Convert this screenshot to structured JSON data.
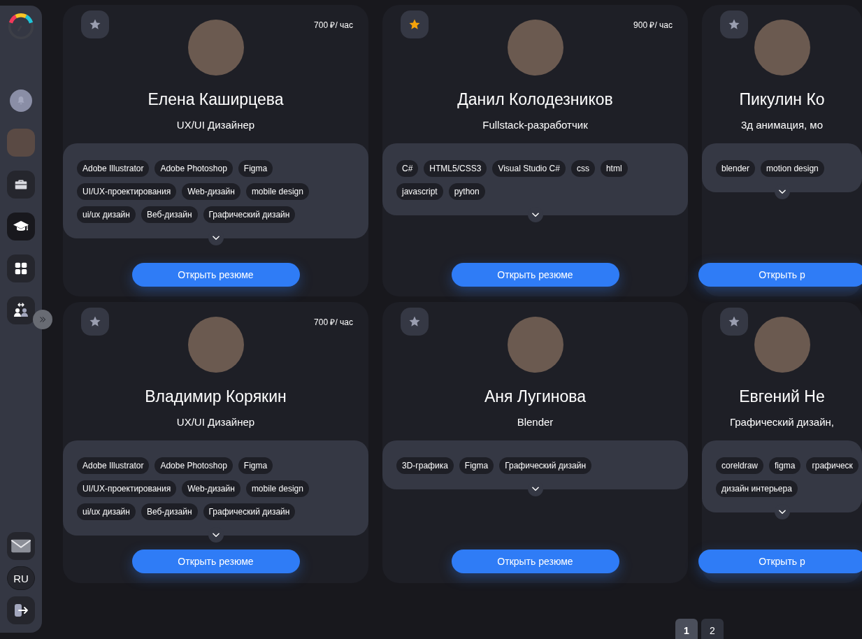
{
  "sidebar": {
    "nav": [
      {
        "kind": "bell",
        "selected": false
      },
      {
        "kind": "avatar",
        "selected": false
      },
      {
        "kind": "briefcase",
        "selected": false
      },
      {
        "kind": "cap",
        "selected": true
      },
      {
        "kind": "grid",
        "selected": false
      },
      {
        "kind": "people",
        "selected": false
      }
    ],
    "language": "RU"
  },
  "cards": [
    {
      "favorite": false,
      "price": "700 ₽/ час",
      "name": "Елена Каширцева",
      "role": "UX/UI Дизайнер",
      "tags": [
        "Adobe Illustrator",
        "Adobe Photoshop",
        "Figma",
        "UI/UX-проектирования",
        "Web-дизайн",
        "mobile design",
        "ui/ux дизайн",
        "Веб-дизайн",
        "Графический дизайн"
      ],
      "action": "Открыть резюме"
    },
    {
      "favorite": true,
      "price": "900 ₽/ час",
      "name": "Данил Колодезников",
      "role": "Fullstack-разработчик",
      "tags": [
        "C#",
        "HTML5/CSS3",
        "Visual Studio C#",
        "css",
        "html",
        "javascript",
        "python"
      ],
      "action": "Открыть резюме"
    },
    {
      "favorite": false,
      "name": "Пикулин Ко",
      "role": "3д анимация, мо",
      "tags": [
        "blender",
        "motion design"
      ],
      "action": "Открыть р"
    },
    {
      "favorite": false,
      "price": "700 ₽/ час",
      "name": "Владимир Корякин",
      "role": "UX/UI Дизайнер",
      "tags": [
        "Adobe Illustrator",
        "Adobe Photoshop",
        "Figma",
        "UI/UX-проектирования",
        "Web-дизайн",
        "mobile design",
        "ui/ux дизайн",
        "Веб-дизайн",
        "Графический дизайн"
      ],
      "action": "Открыть резюме"
    },
    {
      "favorite": false,
      "name": "Аня Лугинова",
      "role": "Blender",
      "tags": [
        "3D-графика",
        "Figma",
        "Графический дизайн"
      ],
      "action": "Открыть резюме"
    },
    {
      "favorite": false,
      "name": "Евгений Не",
      "role": "Графический дизайн,",
      "tags": [
        "coreldraw",
        "figma",
        "графическ",
        "дизайн интерьера"
      ],
      "action": "Открыть р"
    }
  ],
  "pagination": [
    {
      "label": "1",
      "selected": true
    },
    {
      "label": "2",
      "selected": false
    }
  ]
}
